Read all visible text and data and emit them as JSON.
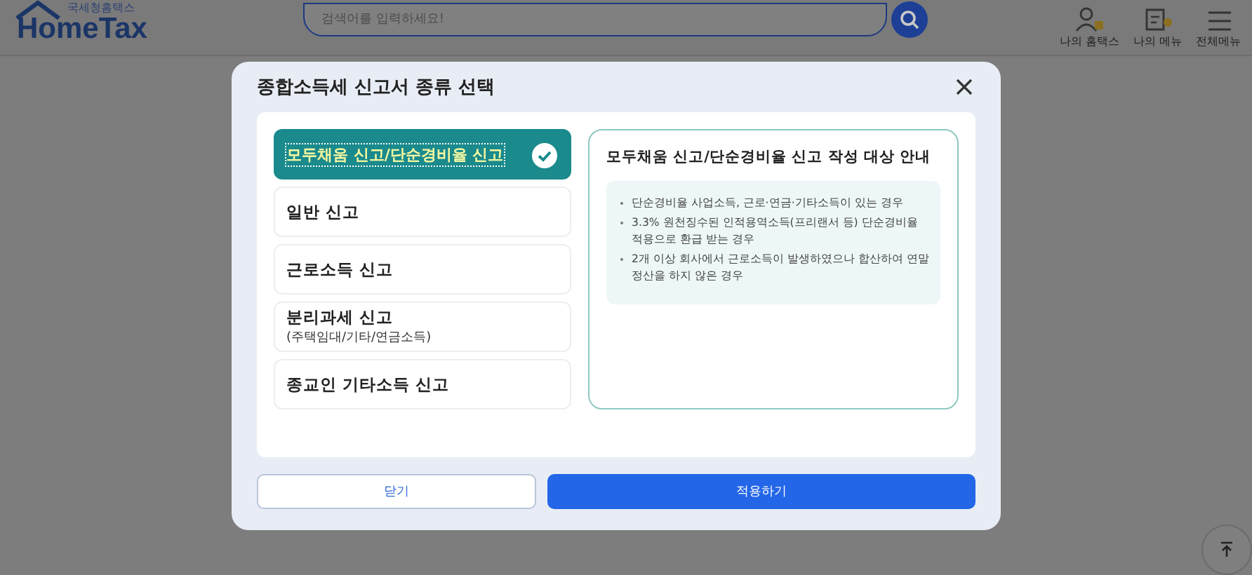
{
  "header": {
    "logo_caption": "국세청홈택스",
    "logo": "HomeTax",
    "search": {
      "placeholder": "검색어를 입력하세요!"
    },
    "nav": [
      {
        "label": "나의 홈택스",
        "kind": "user"
      },
      {
        "label": "나의 메뉴",
        "kind": "list"
      },
      {
        "label": "전체메뉴",
        "kind": "menu"
      }
    ]
  },
  "dialog": {
    "title": "종합소득세 신고서 종류 선택",
    "options": [
      {
        "label": "모두채움 신고/단순경비율 신고",
        "selected": true
      },
      {
        "label": "일반 신고",
        "selected": false
      },
      {
        "label": "근로소득 신고",
        "selected": false
      },
      {
        "label": "분리과세 신고",
        "sublabel": "(주택임대/기타/연금소득)",
        "selected": false
      },
      {
        "label": "종교인 기타소득 신고",
        "selected": false
      }
    ],
    "info": {
      "title": "모두채움 신고/단순경비율 신고 작성 대상 안내",
      "bullets": [
        "단순경비율 사업소득, 근로·연금·기타소득이 있는 경우",
        "3.3% 원천징수된 인적용역소득(프리랜서 등) 단순경비율 적용으로 환급 받는 경우",
        "2개 이상 회사에서 근로소득이 발생하였으나 합산하여 연말정산을 하지 않은 경우"
      ]
    },
    "buttons": [
      {
        "label": "닫기",
        "kind": "secondary"
      },
      {
        "label": "적용하기",
        "kind": "primary"
      }
    ]
  }
}
